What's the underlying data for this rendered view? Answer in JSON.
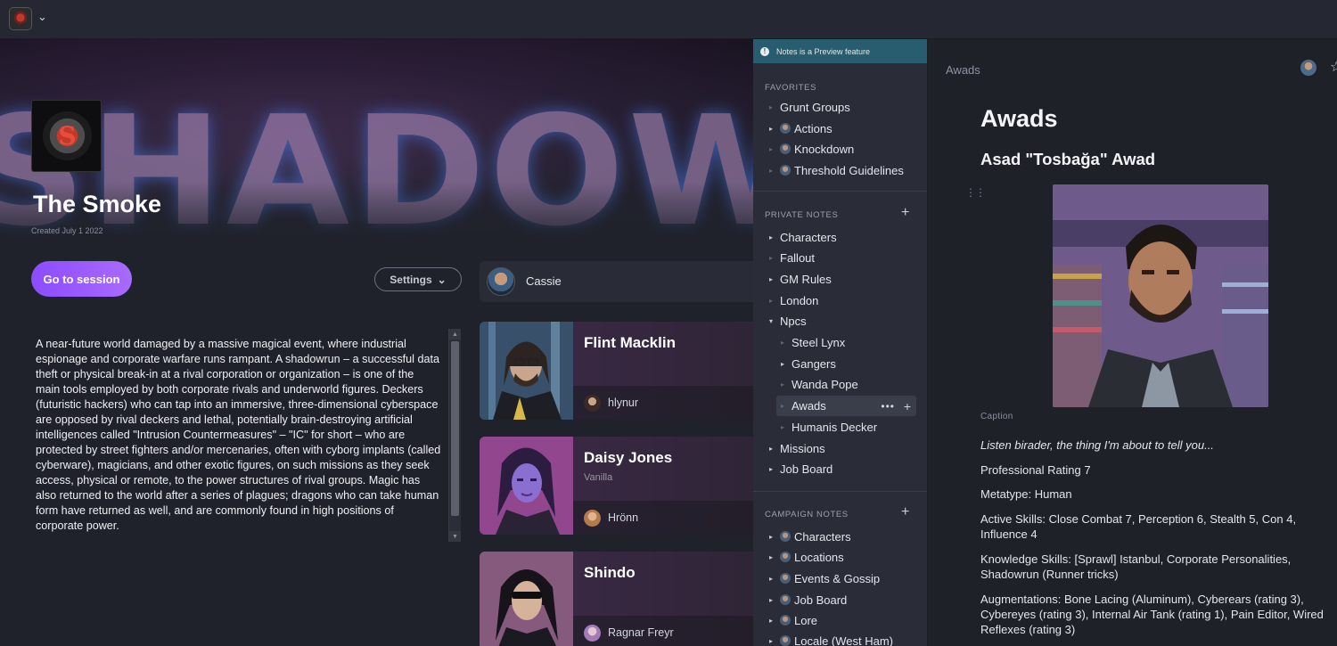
{
  "topbar": {
    "app_logo": "campaign-logo",
    "menu_icon": "chevron-down-icon"
  },
  "campaign": {
    "hero_text": "SHADOW",
    "title": "The Smoke",
    "created": "Created July 1 2022",
    "go_to_session": "Go to session",
    "settings": "Settings",
    "description": "A near-future world damaged by a massive magical event, where industrial espionage and corporate warfare runs rampant. A shadowrun – a successful data theft or physical break-in at a rival corporation or organization – is one of the main tools employed by both corporate rivals and underworld figures. Deckers (futuristic hackers) who can tap into an immersive, three-dimensional cyberspace are opposed by rival deckers and lethal, potentially brain-destroying artificial intelligences called \"Intrusion Countermeasures\" – \"IC\" for short – who are protected by street fighters and/or mercenaries, often with cyborg implants (called cyberware), magicians, and other exotic figures, on such missions as they seek access, physical or remote, to the power structures of rival groups. Magic has also returned to the world after a series of plagues; dragons who can take human form have returned as well, and are commonly found in high positions of corporate power."
  },
  "player": {
    "name": "Cassie"
  },
  "characters": [
    {
      "name": "Flint Macklin",
      "subtitle": "",
      "owner": "hlynur"
    },
    {
      "name": "Daisy Jones",
      "subtitle": "Vanilla",
      "owner": "Hrönn"
    },
    {
      "name": "Shindo",
      "subtitle": "",
      "owner": "Ragnar Freyr"
    }
  ],
  "notes": {
    "banner": "Notes is a Preview feature",
    "favorites_title": "FAVORITES",
    "favorites": [
      {
        "label": "Grunt Groups"
      },
      {
        "label": "Actions"
      },
      {
        "label": "Knockdown"
      },
      {
        "label": "Threshold Guidelines"
      }
    ],
    "private_title": "PRIVATE NOTES",
    "private": [
      {
        "label": "Characters"
      },
      {
        "label": "Fallout"
      },
      {
        "label": "GM Rules"
      },
      {
        "label": "London"
      },
      {
        "label": "Npcs"
      },
      {
        "label": "Steel Lynx"
      },
      {
        "label": "Gangers"
      },
      {
        "label": "Wanda Pope"
      },
      {
        "label": "Awads"
      },
      {
        "label": "Humanis Decker"
      },
      {
        "label": "Missions"
      },
      {
        "label": "Job Board"
      }
    ],
    "campaign_title": "CAMPAIGN NOTES",
    "campaign": [
      {
        "label": "Characters"
      },
      {
        "label": "Locations"
      },
      {
        "label": "Events & Gossip"
      },
      {
        "label": "Job Board"
      },
      {
        "label": "Lore"
      },
      {
        "label": "Locale (West Ham)"
      }
    ]
  },
  "viewer": {
    "breadcrumb": "Awads",
    "heading": "Awads",
    "subheading": "Asad \"Tosbağa\" Awad",
    "caption": "Caption",
    "quote": "Listen birader, the thing I'm about to tell you...",
    "professional_rating": "Professional Rating 7",
    "metatype": "Metatype: Human",
    "active_skills": "Active Skills: Close Combat 7, Perception 6, Stealth 5, Con 4, Influence 4",
    "knowledge_skills": "Knowledge Skills: [Sprawl] Istanbul, Corporate Personalities, Shadowrun (Runner tricks)",
    "augmentations": "Augmentations: Bone Lacing (Aluminum), Cyberears (rating 3), Cybereyes (rating 3), Internal Air Tank (rating 1), Pain Editor, Wired Reflexes (rating 3)"
  },
  "colors": {
    "accent": "#8c4cff",
    "banner": "#275d6f",
    "sidebar": "#2a2d38",
    "background": "#1f222b"
  }
}
